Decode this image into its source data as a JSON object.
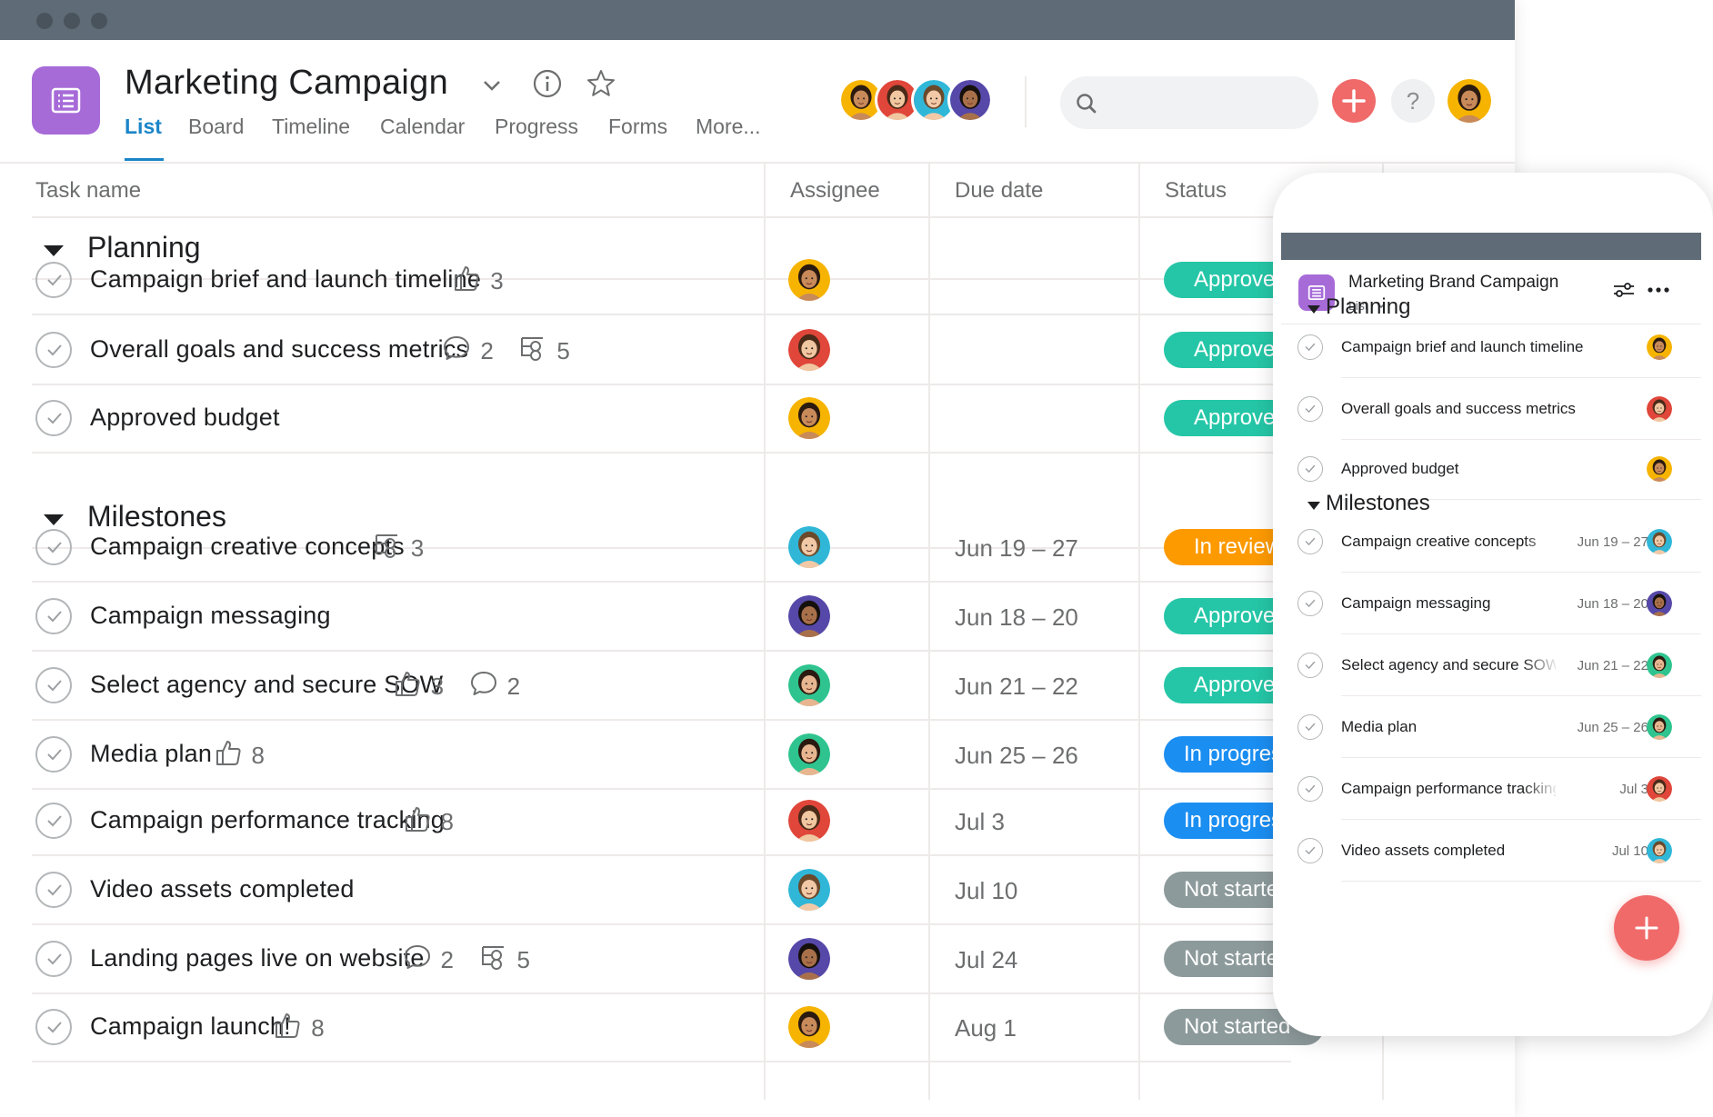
{
  "project": {
    "title": "Marketing Campaign",
    "tabs": [
      "List",
      "Board",
      "Timeline",
      "Calendar",
      "Progress",
      "Forms",
      "More..."
    ],
    "active_tab": "List"
  },
  "search": {
    "placeholder": ""
  },
  "icons": {
    "project": "list-icon",
    "dropdown": "chevron-down-icon",
    "info": "info-icon",
    "favorite": "star-icon",
    "search": "search-icon",
    "add": "plus-icon",
    "help": "question-icon",
    "like": "thumbs-up-icon",
    "comment": "comment-icon",
    "subtask": "subtask-icon"
  },
  "help_label": "?",
  "columns": {
    "task": "Task name",
    "assignee": "Assignee",
    "due": "Due date",
    "status": "Status"
  },
  "colors": {
    "accent": "#1b85c8",
    "project": "#a76bd8",
    "approved": "#25c6a7",
    "in_review": "#fd9a00",
    "in_progress": "#1b8ef2",
    "not_started": "#8d9a9b",
    "add": "#f06a6a"
  },
  "sections": [
    {
      "name": "Planning",
      "tasks": [
        {
          "name": "Campaign brief and launch timeline",
          "likes": "3",
          "comments": "",
          "subtasks": "",
          "assignee": "avatar-a",
          "due": "",
          "status": "Approved",
          "status_key": "approved"
        },
        {
          "name": "Overall goals and success metrics",
          "likes": "",
          "comments": "2",
          "subtasks": "5",
          "assignee": "avatar-b",
          "due": "",
          "status": "Approved",
          "status_key": "approved"
        },
        {
          "name": "Approved budget",
          "likes": "",
          "comments": "",
          "subtasks": "",
          "assignee": "avatar-a",
          "due": "",
          "status": "Approved",
          "status_key": "approved"
        }
      ]
    },
    {
      "name": "Milestones",
      "tasks": [
        {
          "name": "Campaign creative concepts",
          "likes": "",
          "comments": "",
          "subtasks": "3",
          "assignee": "avatar-c",
          "due": "Jun 19 – 27",
          "status": "In review",
          "status_key": "in_review"
        },
        {
          "name": "Campaign messaging",
          "likes": "",
          "comments": "",
          "subtasks": "",
          "assignee": "avatar-d",
          "due": "Jun 18 – 20",
          "status": "Approved",
          "status_key": "approved"
        },
        {
          "name": "Select agency and secure SOW",
          "likes": "3",
          "comments": "2",
          "subtasks": "",
          "assignee": "avatar-e",
          "due": "Jun 21 – 22",
          "status": "Approved",
          "status_key": "approved"
        },
        {
          "name": "Media plan",
          "likes": "8",
          "comments": "",
          "subtasks": "",
          "assignee": "avatar-e",
          "due": "Jun 25 – 26",
          "status": "In progress",
          "status_key": "in_progress"
        },
        {
          "name": "Campaign performance tracking",
          "likes": "8",
          "comments": "",
          "subtasks": "",
          "assignee": "avatar-b",
          "due": "Jul 3",
          "status": "In progress",
          "status_key": "in_progress"
        },
        {
          "name": "Video assets completed",
          "likes": "",
          "comments": "",
          "subtasks": "",
          "assignee": "avatar-c",
          "due": "Jul 10",
          "status": "Not started",
          "status_key": "not_started"
        },
        {
          "name": "Landing pages live on website",
          "likes": "",
          "comments": "2",
          "subtasks": "5",
          "assignee": "avatar-d",
          "due": "Jul 24",
          "status": "Not started",
          "status_key": "not_started"
        },
        {
          "name": "Campaign launch!",
          "likes": "8",
          "comments": "",
          "subtasks": "",
          "assignee": "avatar-a",
          "due": "Aug 1",
          "status": "Not started",
          "status_key": "not_started"
        }
      ]
    }
  ],
  "mobile": {
    "title": "Marketing Brand Campaign",
    "view": "List",
    "menu_icon": "more-icon",
    "filter_icon": "filter-icon",
    "sections": [
      {
        "name": "Planning",
        "tasks": [
          {
            "name": "Campaign brief and launch timeline",
            "due": "",
            "assignee": "avatar-a"
          },
          {
            "name": "Overall goals and success metrics",
            "due": "",
            "assignee": "avatar-b"
          },
          {
            "name": "Approved budget",
            "due": "",
            "assignee": "avatar-a"
          }
        ]
      },
      {
        "name": "Milestones",
        "tasks": [
          {
            "name": "Campaign creative concepts",
            "due": "Jun 19 – 27",
            "assignee": "avatar-c"
          },
          {
            "name": "Campaign messaging",
            "due": "Jun 18 – 20",
            "assignee": "avatar-d"
          },
          {
            "name": "Select agency and secure SOW",
            "due": "Jun 21 – 22",
            "assignee": "avatar-e"
          },
          {
            "name": "Media plan",
            "due": "Jun 25 – 26",
            "assignee": "avatar-e"
          },
          {
            "name": "Campaign performance tracking",
            "due": "Jul 3",
            "assignee": "avatar-b"
          },
          {
            "name": "Video assets completed",
            "due": "Jul 10",
            "assignee": "avatar-c"
          }
        ]
      }
    ]
  },
  "avatars": {
    "avatar-a": {
      "bg": "#f6b400",
      "skin": "#c98a5a",
      "hair": "#2b1a10"
    },
    "avatar-b": {
      "bg": "#e0463a",
      "skin": "#f0c7a0",
      "hair": "#4a2a18"
    },
    "avatar-c": {
      "bg": "#30b7d8",
      "skin": "#f2c9a6",
      "hair": "#6b4a2c"
    },
    "avatar-d": {
      "bg": "#5648a8",
      "skin": "#a8704a",
      "hair": "#15100c"
    },
    "avatar-e": {
      "bg": "#2fc48f",
      "skin": "#e7b690",
      "hair": "#2a1a10"
    }
  },
  "members": [
    "avatar-a",
    "avatar-b",
    "avatar-c",
    "avatar-d"
  ],
  "current_user": "avatar-a"
}
